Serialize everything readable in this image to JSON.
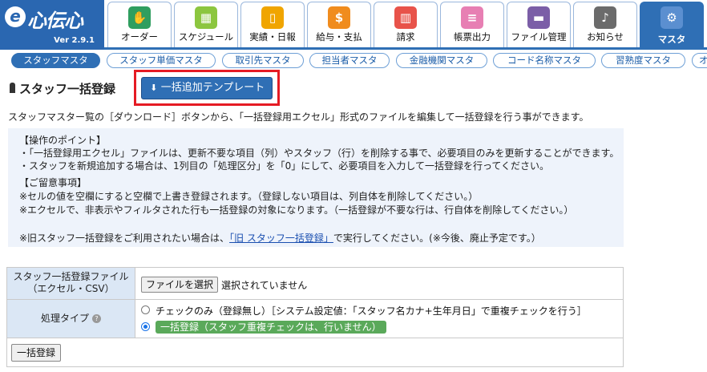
{
  "app": {
    "logo_mark": "e",
    "logo_text": "心伝心",
    "version": "Ver 2.9.1"
  },
  "nav": {
    "tabs": [
      {
        "label": "オーダー",
        "icon": "handshake-icon",
        "glyph": "✋",
        "color": "#2f9e5f"
      },
      {
        "label": "スケジュール",
        "icon": "calendar-icon",
        "glyph": "▦",
        "color": "#8cc63f"
      },
      {
        "label": "実績・日報",
        "icon": "book-icon",
        "glyph": "▯",
        "color": "#f0a500"
      },
      {
        "label": "給与・支払",
        "icon": "person-coin-icon",
        "glyph": "$",
        "color": "#f08c1e"
      },
      {
        "label": "請求",
        "icon": "building-icon",
        "glyph": "▥",
        "color": "#e8534a"
      },
      {
        "label": "帳票出力",
        "icon": "papers-icon",
        "glyph": "≡",
        "color": "#e77fb3"
      },
      {
        "label": "ファイル管理",
        "icon": "folder-icon",
        "glyph": "▬",
        "color": "#7b5ea7"
      },
      {
        "label": "お知らせ",
        "icon": "bell-icon",
        "glyph": "♪",
        "color": "#6b6b6b"
      },
      {
        "label": "マスタ",
        "icon": "database-gear-icon",
        "glyph": "⚙",
        "color": "#5b8fd0"
      }
    ]
  },
  "subnav": {
    "items": [
      {
        "label": "スタッフマスタ"
      },
      {
        "label": "スタッフ単価マスタ"
      },
      {
        "label": "取引先マスタ"
      },
      {
        "label": "担当者マスタ"
      },
      {
        "label": "金融機関マスタ"
      },
      {
        "label": "コード名称マスタ"
      },
      {
        "label": "習熟度マスタ"
      },
      {
        "label": "オ"
      }
    ]
  },
  "page": {
    "title": "スタッフ一括登録",
    "template_button": "一括追加テンプレート",
    "description": "スタッフマスター覧の［ダウンロード］ボタンから、「一括登録用エクセル」形式のファイルを編集して一括登録を行う事ができます。"
  },
  "info": {
    "points_heading": "【操作のポイント】",
    "point1": "・「一括登録用エクセル」ファイルは、更新不要な項目（列）やスタッフ（行）を削除する事で、必要項目のみを更新することができます。",
    "point2": "・スタッフを新規追加する場合は、1列目の「処理区分」を「0」にして、必要項目を入力して一括登録を行ってください。",
    "notes_heading": "【ご留意事項】",
    "note1": "※セルの値を空欄にすると空欄で上書き登録されます。（登録しない項目は、列自体を削除してください。）",
    "note2": "※エクセルで、非表示やフィルタされた行も一括登録の対象になります。（一括登録が不要な行は、行自体を削除してください。）",
    "legacy_prefix": "※旧スタッフ一括登録をご利用されたい場合は、",
    "legacy_link": "「旧 スタッフ一括登録」",
    "legacy_suffix": "で実行してください。(※今後、廃止予定です。）"
  },
  "form": {
    "file_label_line1": "スタッフ一括登録ファイル",
    "file_label_line2": "（エクセル・CSV）",
    "file_button": "ファイルを選択",
    "file_status": "選択されていません",
    "type_label": "処理タイプ",
    "option_check": "チェックのみ（登録無し）［システム設定値：「スタッフ名カナ+生年月日」で重複チェックを行う］",
    "option_bulk": "一括登録（スタッフ重複チェックは、行いません）",
    "selected_option": "bulk",
    "submit": "一括登録"
  }
}
